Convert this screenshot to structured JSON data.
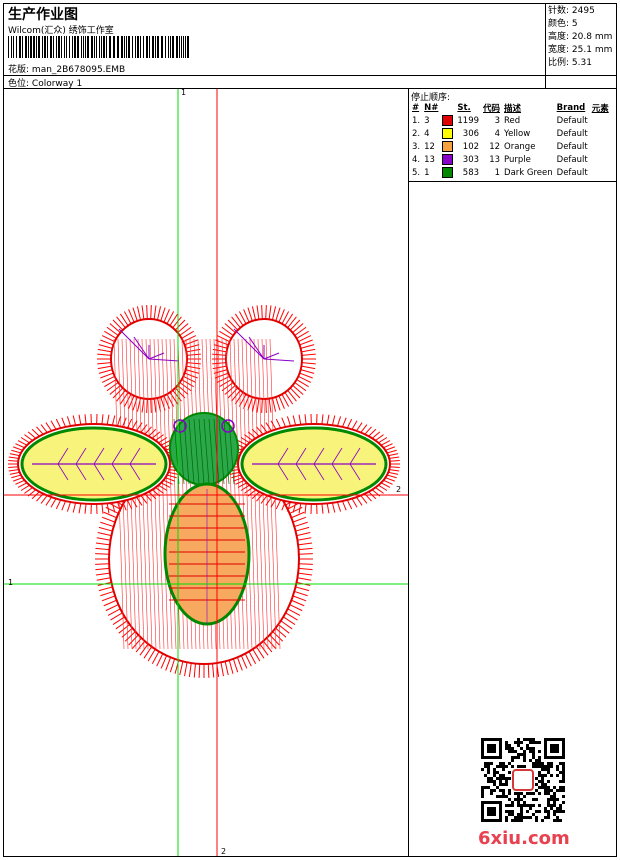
{
  "header": {
    "title": "生产作业图",
    "subtitle": "Wilcom(汇众) 绣饰工作室",
    "design_label": "花版:",
    "design_name": "man_2B678095.EMB",
    "colorway_label": "色位:",
    "colorway_name": "Colorway 1"
  },
  "stats": [
    {
      "label": "针数:",
      "value": "2495"
    },
    {
      "label": "颜色:",
      "value": "5"
    },
    {
      "label": "高度:",
      "value": "20.8 mm"
    },
    {
      "label": "宽度:",
      "value": "25.1 mm"
    },
    {
      "label": "比例:",
      "value": "5.31"
    }
  ],
  "stop_sequence": {
    "title": "停止顺序:",
    "headers": [
      "#",
      "N#",
      "St.",
      "代码",
      "描述",
      "Brand",
      "元素"
    ],
    "rows": [
      {
        "idx": "1.",
        "n": "3",
        "st": "1199",
        "code": "3",
        "desc": "Red",
        "brand": "Default",
        "color": "#e00000"
      },
      {
        "idx": "2.",
        "n": "4",
        "st": "306",
        "code": "4",
        "desc": "Yellow",
        "brand": "Default",
        "color": "#ffff00"
      },
      {
        "idx": "3.",
        "n": "12",
        "st": "102",
        "code": "12",
        "desc": "Orange",
        "brand": "Default",
        "color": "#f7a040"
      },
      {
        "idx": "4.",
        "n": "13",
        "st": "303",
        "code": "13",
        "desc": "Purple",
        "brand": "Default",
        "color": "#8a00c8"
      },
      {
        "idx": "5.",
        "n": "1",
        "st": "583",
        "code": "1",
        "desc": "Dark Green",
        "brand": "Default",
        "color": "#008800"
      }
    ]
  },
  "axes": {
    "v_top": "1",
    "v_bottom": "2",
    "h_left": "1",
    "h_right": "2"
  },
  "watermark": "6xiu.com"
}
